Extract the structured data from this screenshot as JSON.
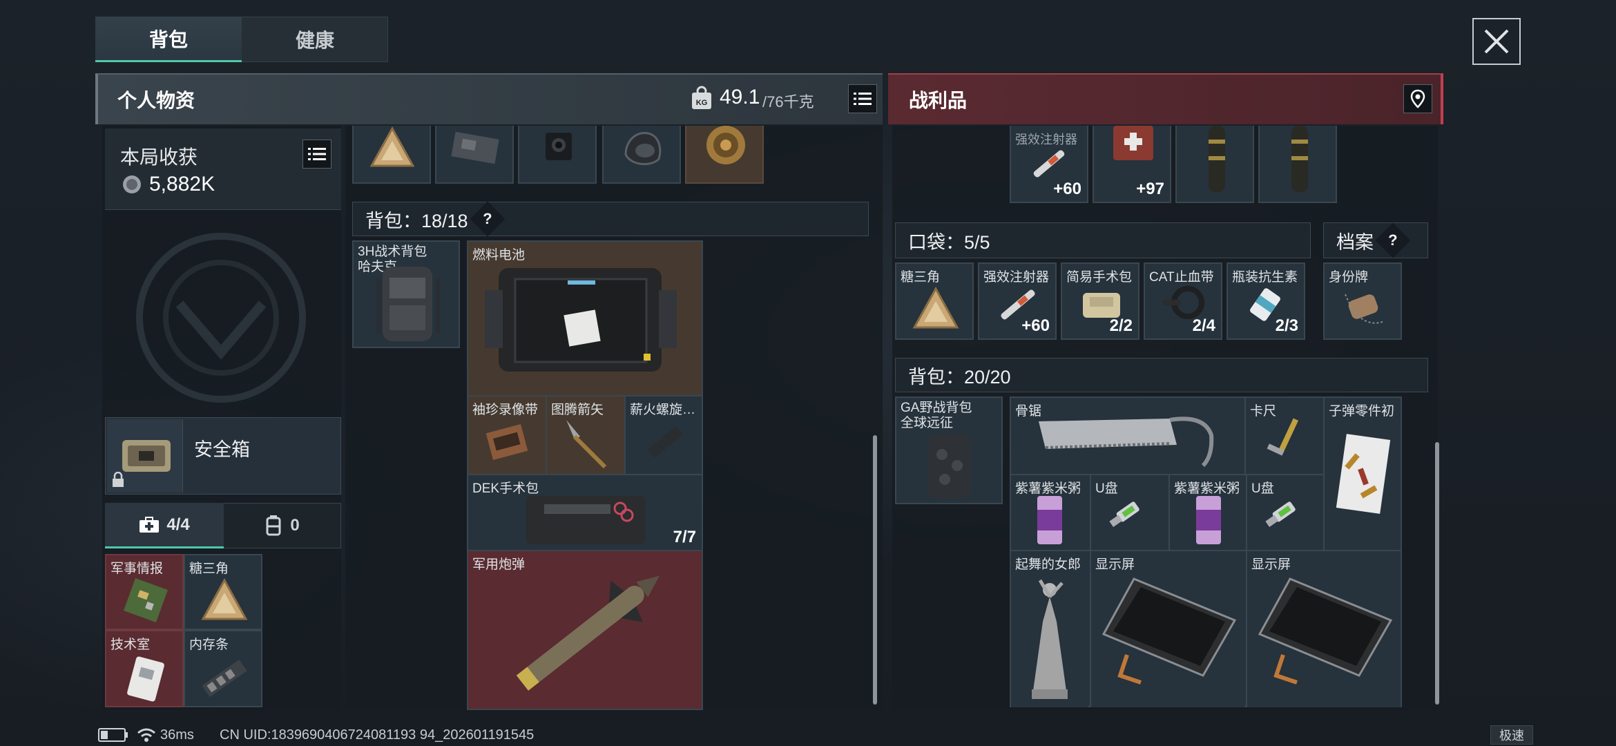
{
  "tabs": {
    "backpack": "背包",
    "health": "健康"
  },
  "personal": {
    "title": "个人物资",
    "weight_value": "49.1",
    "weight_max": "/76千克",
    "round_gain_label": "本局收获",
    "round_gain_value": "5,882K",
    "safebox_label": "安全箱",
    "medkit_count": "4/4",
    "other_count": "0",
    "safebox_items": [
      "军事情报",
      "糖三角",
      "技术室",
      "内存条"
    ]
  },
  "backpack_left": {
    "header": "背包：18/18",
    "bag_name": "3H战术背包\n哈夫克",
    "items": [
      "燃料电池",
      "袖珍录像带",
      "图腾箭矢",
      "薪火螺旋…",
      "DEK手术包",
      "军用炮弹"
    ],
    "dek_qty": "7/7"
  },
  "loot": {
    "title": "战利品",
    "top_items": [
      {
        "name": "强效注射器",
        "qty": "+60"
      },
      {
        "name": "",
        "qty": "+97"
      }
    ],
    "pocket_header": "口袋：5/5",
    "archive_label": "档案",
    "pockets": [
      {
        "name": "糖三角",
        "qty": ""
      },
      {
        "name": "强效注射器",
        "qty": "+60"
      },
      {
        "name": "简易手术包",
        "qty": "2/2"
      },
      {
        "name": "CAT止血带",
        "qty": "2/4"
      },
      {
        "name": "瓶装抗生素",
        "qty": "2/3"
      }
    ],
    "archive_item": "身份牌",
    "backpack_header": "背包：20/20",
    "bag_name": "GA野战背包\n全球远征",
    "items": [
      "骨锯",
      "卡尺",
      "子弹零件初",
      "紫薯紫米粥",
      "U盘",
      "紫薯紫米粥",
      "U盘",
      "起舞的女郎",
      "显示屏",
      "显示屏"
    ]
  },
  "status": {
    "ping": "36ms",
    "uid": "CN UID:1839690406724081193 94_202601191545",
    "mode": "极速"
  }
}
